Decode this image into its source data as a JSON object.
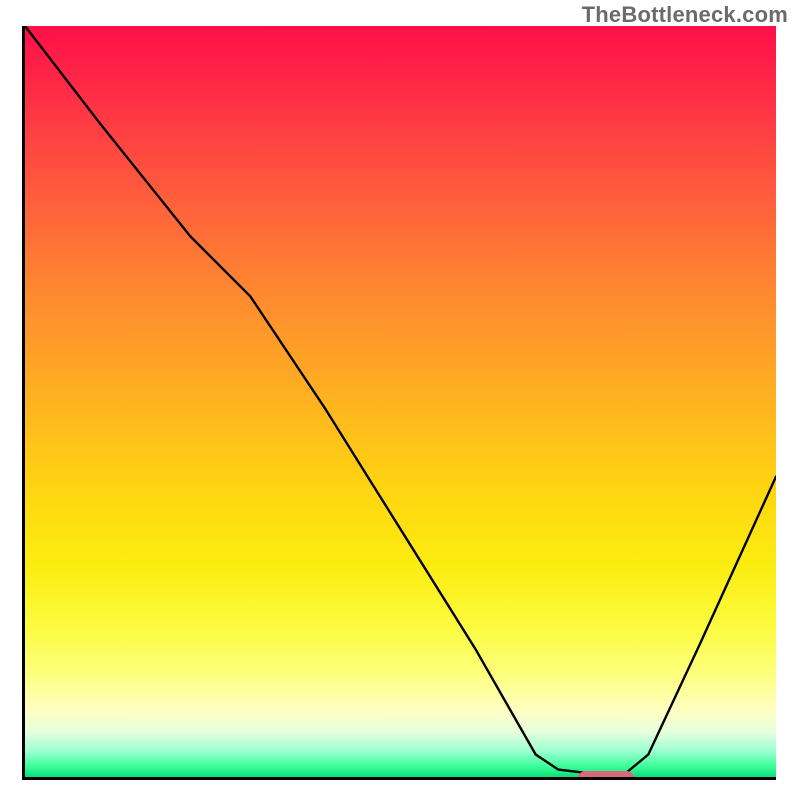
{
  "watermark": "TheBottleneck.com",
  "chart_data": {
    "type": "line",
    "title": "",
    "xlabel": "",
    "ylabel": "",
    "xlim": [
      0,
      100
    ],
    "ylim": [
      0,
      100
    ],
    "grid": false,
    "background": "rainbow-gradient-red-to-green-vertical",
    "series": [
      {
        "name": "bottleneck-curve",
        "x": [
          0,
          10,
          22,
          30,
          40,
          50,
          60,
          68,
          71,
          75,
          80,
          83,
          90,
          100
        ],
        "y": [
          100,
          87,
          72,
          64,
          49,
          33,
          17,
          3,
          1,
          0.5,
          0.5,
          3,
          18,
          40
        ],
        "color": "#000000"
      }
    ],
    "marker": {
      "name": "optimum-segment",
      "x_center": 77,
      "y_center": 0,
      "color": "#d9687b"
    },
    "axes": {
      "left": true,
      "bottom": true,
      "right": false,
      "top": false,
      "ticks": "none"
    }
  }
}
